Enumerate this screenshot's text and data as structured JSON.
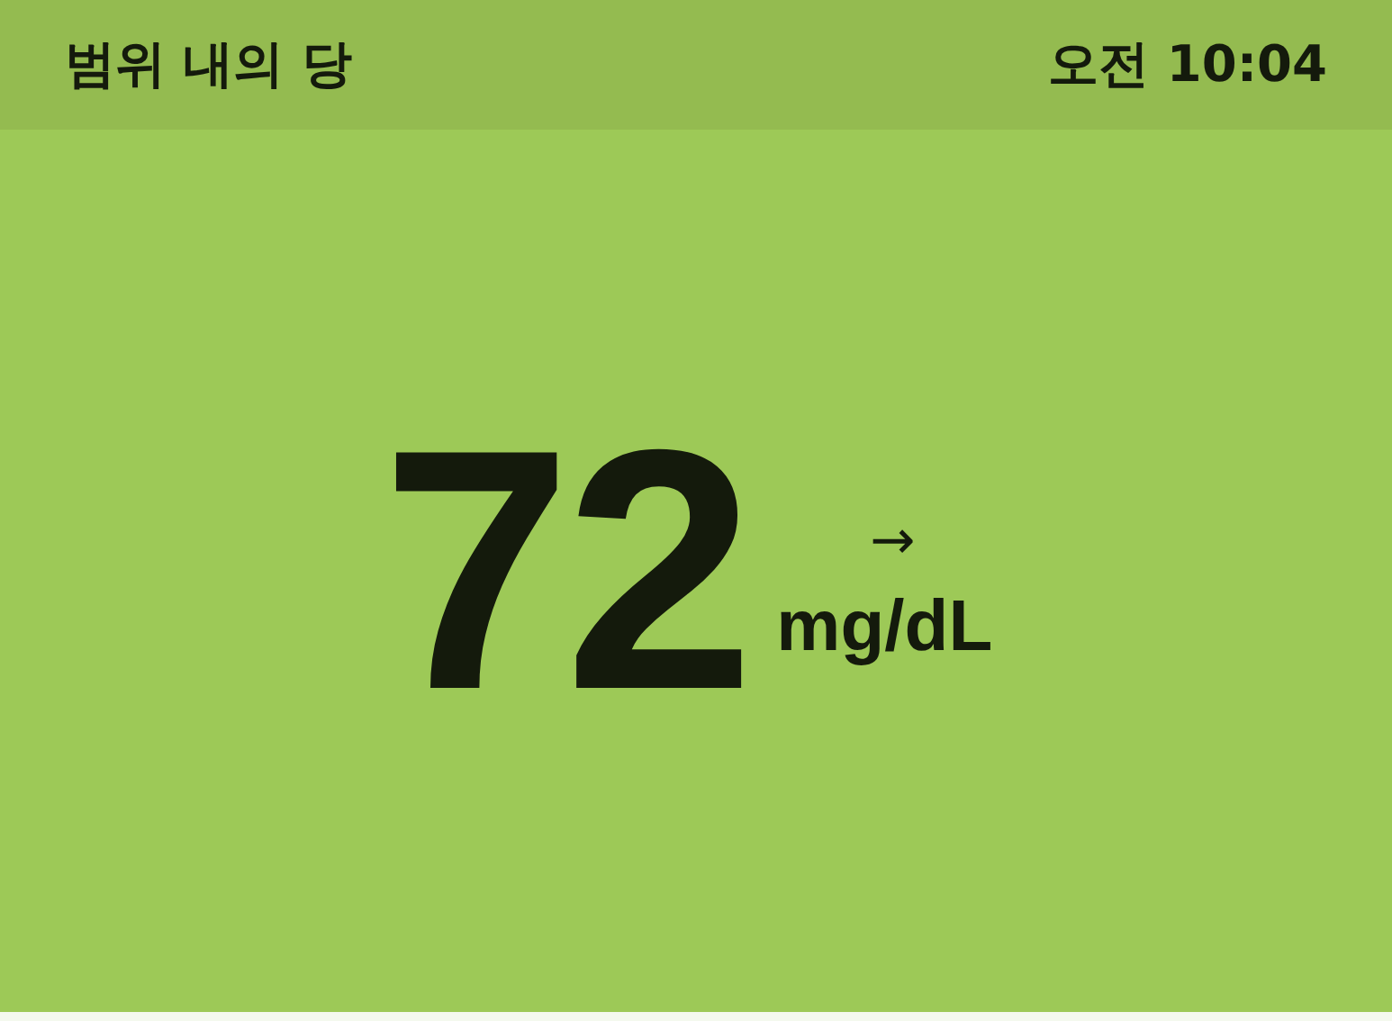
{
  "header": {
    "title": "범위 내의 당",
    "time": "오전 10:04"
  },
  "reading": {
    "value": "72",
    "trend": "→",
    "unit": "mg/dL"
  }
}
